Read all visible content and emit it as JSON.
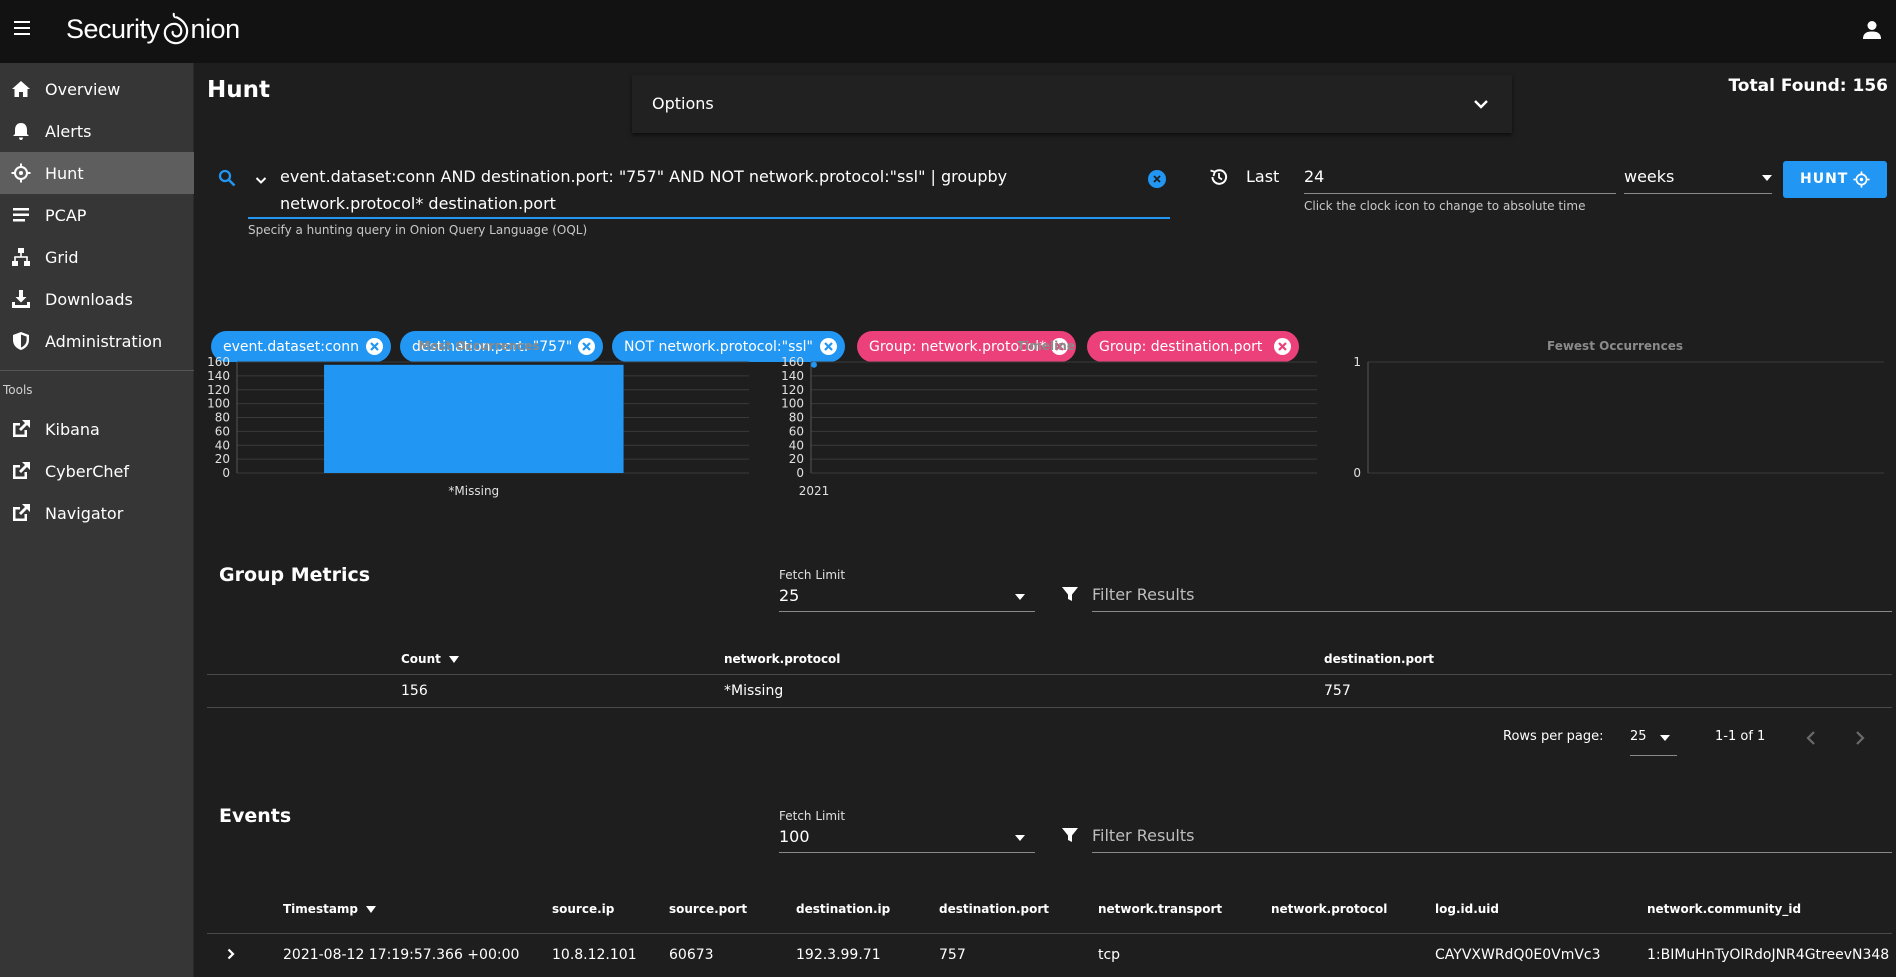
{
  "app": {
    "logo_text": "Security",
    "logo_text2": "nion"
  },
  "sidebar": {
    "items": [
      {
        "label": "Overview"
      },
      {
        "label": "Alerts"
      },
      {
        "label": "Hunt"
      },
      {
        "label": "PCAP"
      },
      {
        "label": "Grid"
      },
      {
        "label": "Downloads"
      },
      {
        "label": "Administration"
      }
    ],
    "tools_heading": "Tools",
    "tools": [
      {
        "label": "Kibana"
      },
      {
        "label": "CyberChef"
      },
      {
        "label": "Navigator"
      }
    ]
  },
  "page": {
    "title": "Hunt",
    "options_label": "Options",
    "total_found": "Total Found: 156"
  },
  "query": {
    "line1": "event.dataset:conn AND destination.port: \"757\" AND NOT network.protocol:\"ssl\" | groupby",
    "line2": "network.protocol* destination.port",
    "hint": "Specify a hunting query in Onion Query Language (OQL)"
  },
  "time": {
    "last_label": "Last",
    "amount": "24",
    "unit": "weeks",
    "hint": "Click the clock icon to change to absolute time",
    "hunt_button": "HUNT"
  },
  "chips": [
    {
      "label": "event.dataset:conn",
      "kind": "filter"
    },
    {
      "label": "destination.port: \"757\"",
      "kind": "filter"
    },
    {
      "label": "NOT network.protocol:\"ssl\"",
      "kind": "filter"
    },
    {
      "label": "Group: network.protocol*",
      "kind": "group"
    },
    {
      "label": "Group: destination.port",
      "kind": "group"
    }
  ],
  "chart_data": [
    {
      "type": "bar",
      "title": "Most Occurrences",
      "categories": [
        "*Missing"
      ],
      "values": [
        156
      ],
      "ylim": [
        0,
        160
      ],
      "yticks": [
        "160",
        "140",
        "120",
        "100",
        "80",
        "60",
        "40",
        "20",
        "0"
      ],
      "color": "#2196f3"
    },
    {
      "type": "line",
      "title": "Timeline",
      "x": [
        "2021"
      ],
      "values": [
        156
      ],
      "ylim": [
        0,
        160
      ],
      "yticks": [
        "160",
        "140",
        "120",
        "100",
        "80",
        "60",
        "40",
        "20",
        "0"
      ],
      "color": "#2196f3"
    },
    {
      "type": "bar",
      "title": "Fewest Occurrences",
      "categories": [],
      "values": [],
      "ylim": [
        0,
        1
      ],
      "yticks": [
        "1",
        "0"
      ]
    }
  ],
  "group_metrics": {
    "title": "Group Metrics",
    "fetch_limit_label": "Fetch Limit",
    "fetch_limit": "25",
    "filter_placeholder": "Filter Results",
    "columns": [
      "Count",
      "network.protocol",
      "destination.port"
    ],
    "rows": [
      [
        "156",
        "*Missing",
        "757"
      ]
    ],
    "rows_per_page_label": "Rows per page:",
    "rows_per_page": "25",
    "range": "1-1 of 1"
  },
  "events": {
    "title": "Events",
    "fetch_limit_label": "Fetch Limit",
    "fetch_limit": "100",
    "filter_placeholder": "Filter Results",
    "columns": [
      "Timestamp",
      "source.ip",
      "source.port",
      "destination.ip",
      "destination.port",
      "network.transport",
      "network.protocol",
      "log.id.uid",
      "network.community_id"
    ],
    "rows": [
      [
        "2021-08-12 17:19:57.366 +00:00",
        "10.8.12.101",
        "60673",
        "192.3.99.71",
        "757",
        "tcp",
        "",
        "CAYVXWRdQ0E0VmVc3",
        "1:BIMuHnTyOlRdoJNR4GtreevN348"
      ]
    ]
  },
  "colors": {
    "accent": "#2196f3",
    "group_chip": "#ec407a",
    "sidebar_active": "#5e5e5e"
  }
}
